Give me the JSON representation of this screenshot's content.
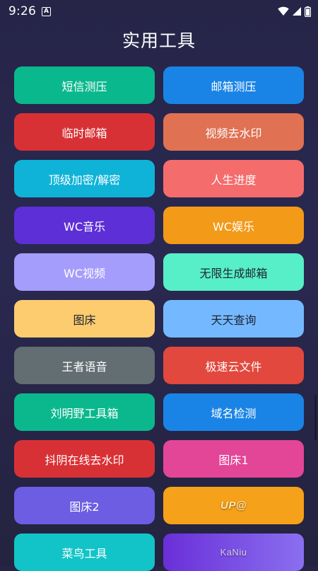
{
  "status_bar": {
    "time": "9:26",
    "notification_glyph": "A",
    "icons": [
      "wifi-icon",
      "signal-icon",
      "battery-icon"
    ]
  },
  "page": {
    "title": "实用工具"
  },
  "tools": [
    {
      "label": "短信测压",
      "color": "#0ab88e"
    },
    {
      "label": "邮箱测压",
      "color": "#1a84e6"
    },
    {
      "label": "临时邮箱",
      "color": "#d83135"
    },
    {
      "label": "视频去水印",
      "color": "#e07152"
    },
    {
      "label": "顶级加密/解密",
      "color": "#0fb3d8"
    },
    {
      "label": "人生进度",
      "color": "#f46c6c"
    },
    {
      "label": "WC音乐",
      "color": "#5d2fd6"
    },
    {
      "label": "WC娱乐",
      "color": "#f39a19"
    },
    {
      "label": "WC视频",
      "color": "#a59dfc"
    },
    {
      "label": "无限生成邮箱",
      "color": "#57efc7"
    },
    {
      "label": "图床",
      "color": "#fdcc6e"
    },
    {
      "label": "天天查询",
      "color": "#74b9ff"
    },
    {
      "label": "王者语音",
      "color": "#636e72"
    },
    {
      "label": "极速云文件",
      "color": "#e2483d"
    },
    {
      "label": "刘明野工具箱",
      "color": "#0bb88e"
    },
    {
      "label": "域名检测",
      "color": "#1a84e6"
    },
    {
      "label": "抖阴在线去水印",
      "color": "#d83135"
    },
    {
      "label": "图床1",
      "color": "#e34597"
    },
    {
      "label": "图床2",
      "color": "#6c5de3"
    },
    {
      "label": "UP@",
      "color": "#f6a11a"
    },
    {
      "label": "菜鸟工具",
      "color": "#12c4c8"
    },
    {
      "label": "KaNiu",
      "color": "#6a2fd8"
    }
  ]
}
